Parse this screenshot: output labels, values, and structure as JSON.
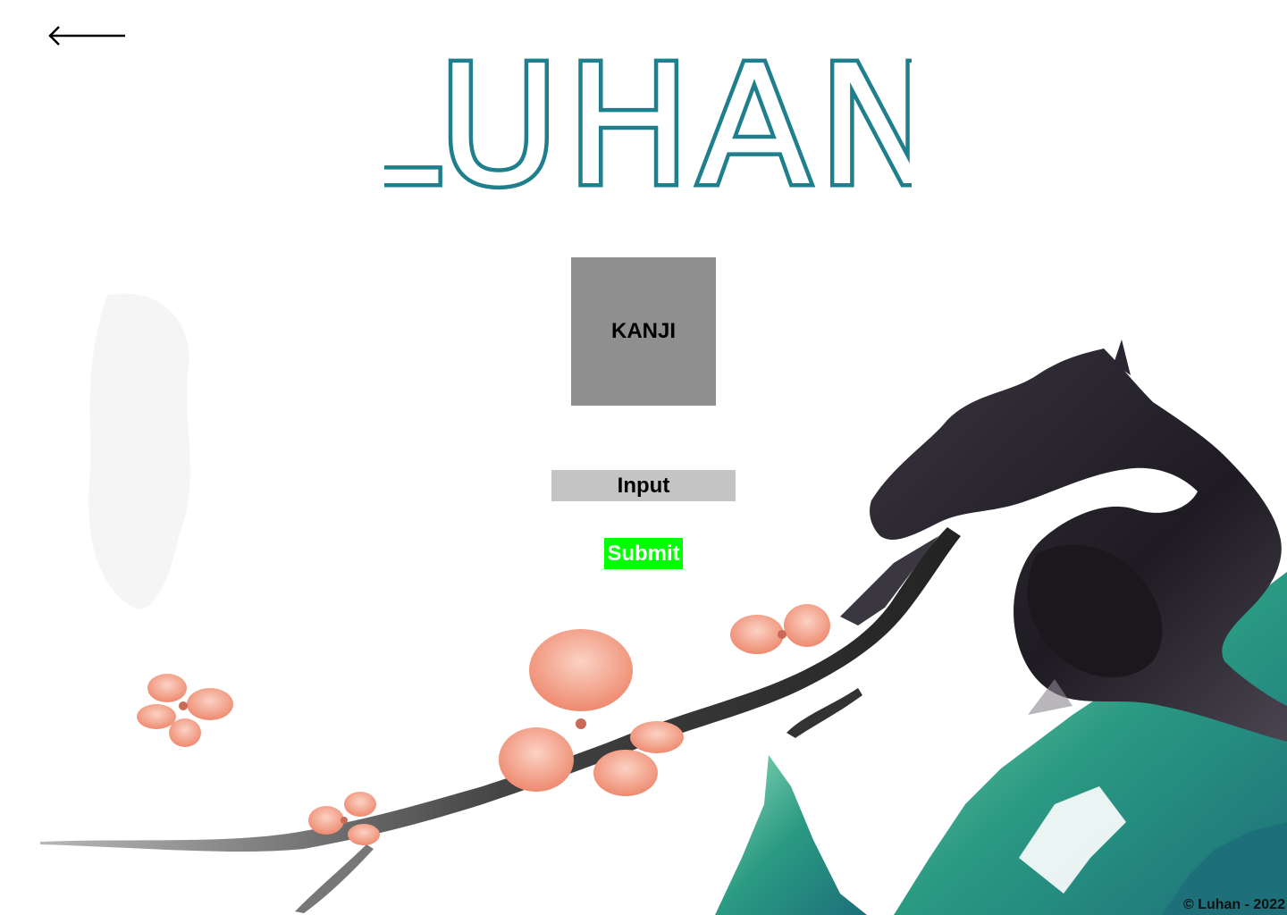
{
  "header": {
    "back_icon": "arrow-left-icon",
    "logo_text": "LUHAN"
  },
  "main": {
    "kanji_label": "KANJI",
    "input_label": "Input",
    "submit_label": "Submit"
  },
  "footer": {
    "copyright": "© Luhan - 2022"
  },
  "colors": {
    "logo": "#1f7f8c",
    "kanji_card": "#8f8f8f",
    "input_bg": "#c4c4c4",
    "submit_bg": "#00ff00",
    "submit_text": "#ffffff",
    "blossom": "#f0967d",
    "dragon": "#2b2730",
    "mountain": "#2a9a82"
  }
}
